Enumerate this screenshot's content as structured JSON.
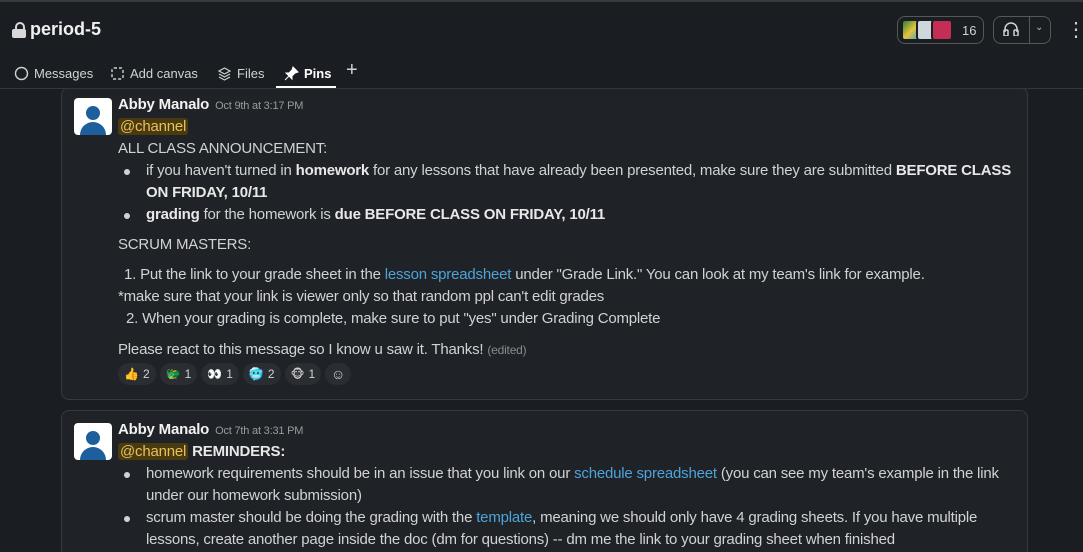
{
  "channel": {
    "name": "period-5",
    "member_count": "16"
  },
  "tabs": [
    {
      "label": "Messages"
    },
    {
      "label": "Add canvas"
    },
    {
      "label": "Files"
    },
    {
      "label": "Pins"
    }
  ],
  "messages": [
    {
      "author": "Abby Manalo",
      "time": "Oct 9th at 3:17 PM",
      "mention": "@channel",
      "l1": "ALL CLASS ANNOUNCEMENT:",
      "b1a": "if you haven't turned in ",
      "b1b": "homework",
      "b1c": " for any lessons that have already been presented, make sure they are submitted ",
      "b1d": "BEFORE CLASS",
      "b1e": "ON FRIDAY, 10/11",
      "b2a": "grading",
      "b2b": " for the homework is ",
      "b2c": "due BEFORE CLASS ON FRIDAY, 10/11",
      "scrum": "SCRUM MASTERS:",
      "o1a": "1.  Put the link to your grade sheet in the ",
      "o1link": "lesson spreadsheet",
      "o1b": " under \"Grade Link.\" You can look at my team's link for example.",
      "note": "*make sure that your link is viewer only so that random ppl can't edit grades",
      "o2": "2. When your grading is complete, make sure to put \"yes\" under Grading Complete",
      "closing": "Please react to this message so I know u saw it. Thanks!",
      "edited": "(edited)",
      "reactions": [
        {
          "emoji": "👍",
          "count": "2"
        },
        {
          "emoji": "🐲",
          "count": "1"
        },
        {
          "emoji": "👀",
          "count": "1"
        },
        {
          "emoji": "🥶",
          "count": "2"
        },
        {
          "emoji": "🐵",
          "count": "1"
        }
      ]
    },
    {
      "author": "Abby Manalo",
      "time": "Oct 7th at 3:31 PM",
      "mention": "@channel",
      "title": "REMINDERS:",
      "r1a": "homework requirements should be in an issue that you link on our ",
      "r1link": "schedule spreadsheet",
      "r1b": " (you can see my team's example in the link",
      "r1c": "under our homework submission)",
      "r2a": "scrum master should be doing the grading with the ",
      "r2link": "template",
      "r2b": ", meaning we should only have 4 grading sheets. If you have multiple",
      "r2c": "lessons, create another page inside the doc (dm for questions) -- dm me the link to your grading sheet when finished"
    }
  ]
}
